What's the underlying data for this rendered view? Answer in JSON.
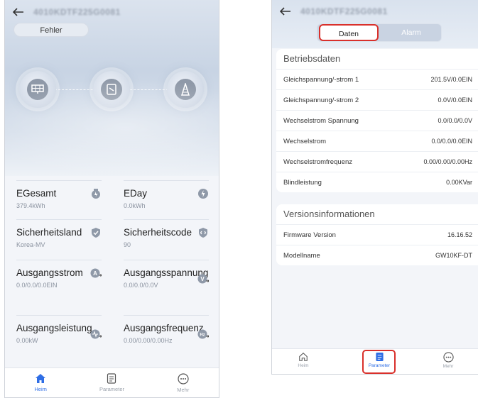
{
  "left": {
    "serial": "4010KDTF225G0081",
    "status": "Fehler",
    "cells": [
      {
        "title": "EGesamt",
        "value": "379.4kWh",
        "icon": "energy-total-icon"
      },
      {
        "title": "EDay",
        "value": "0.0kWh",
        "icon": "energy-day-icon"
      },
      {
        "title": "Sicherheitsland",
        "value": "Korea-MV",
        "icon": "shield-check-icon"
      },
      {
        "title": "Sicherheitscode",
        "value": "90",
        "icon": "shield-code-icon"
      },
      {
        "title": "Ausgangsstrom",
        "value": "0.0/0.0/0.0EIN",
        "icon": "current-output-icon"
      },
      {
        "title": "Ausgangsspannung",
        "value": "0.0/0.0/0.0V",
        "icon": "voltage-output-icon"
      },
      {
        "title": "Ausgangsleistung",
        "value": "0.00kW",
        "icon": "power-output-icon"
      },
      {
        "title": "Ausgangsfrequenz",
        "value": "0.00/0.00/0.00Hz",
        "icon": "frequency-output-icon"
      }
    ],
    "tabs": {
      "home": "Heim",
      "params": "Parameter",
      "more": "Mehr"
    }
  },
  "right": {
    "serial": "4010KDTF225G0081",
    "segment": {
      "data": "Daten",
      "alarm": "Alarm"
    },
    "operating": {
      "title": "Betriebsdaten",
      "rows": [
        {
          "k": "Gleichspannung/-strom 1",
          "v": "201.5V/0.0EIN"
        },
        {
          "k": "Gleichspannung/-strom 2",
          "v": "0.0V/0.0EIN"
        },
        {
          "k": "Wechselstrom Spannung",
          "v": "0.0/0.0/0.0V"
        },
        {
          "k": "Wechselstrom",
          "v": "0.0/0.0/0.0EIN"
        },
        {
          "k": "Wechselstromfrequenz",
          "v": "0.00/0.00/0.00Hz"
        },
        {
          "k": "Blindleistung",
          "v": "0.00KVar"
        }
      ]
    },
    "version": {
      "title": "Versionsinformationen",
      "rows": [
        {
          "k": "Firmware Version",
          "v": "16.16.52"
        },
        {
          "k": "Modellname",
          "v": "GW10KF-DT"
        }
      ]
    },
    "tabs": {
      "home": "Heim",
      "params": "Parameter",
      "more": "Mehr"
    }
  },
  "colors": {
    "accent": "#2f6ee5",
    "highlight": "#d9302b",
    "icon_grey": "#8f99a8"
  }
}
